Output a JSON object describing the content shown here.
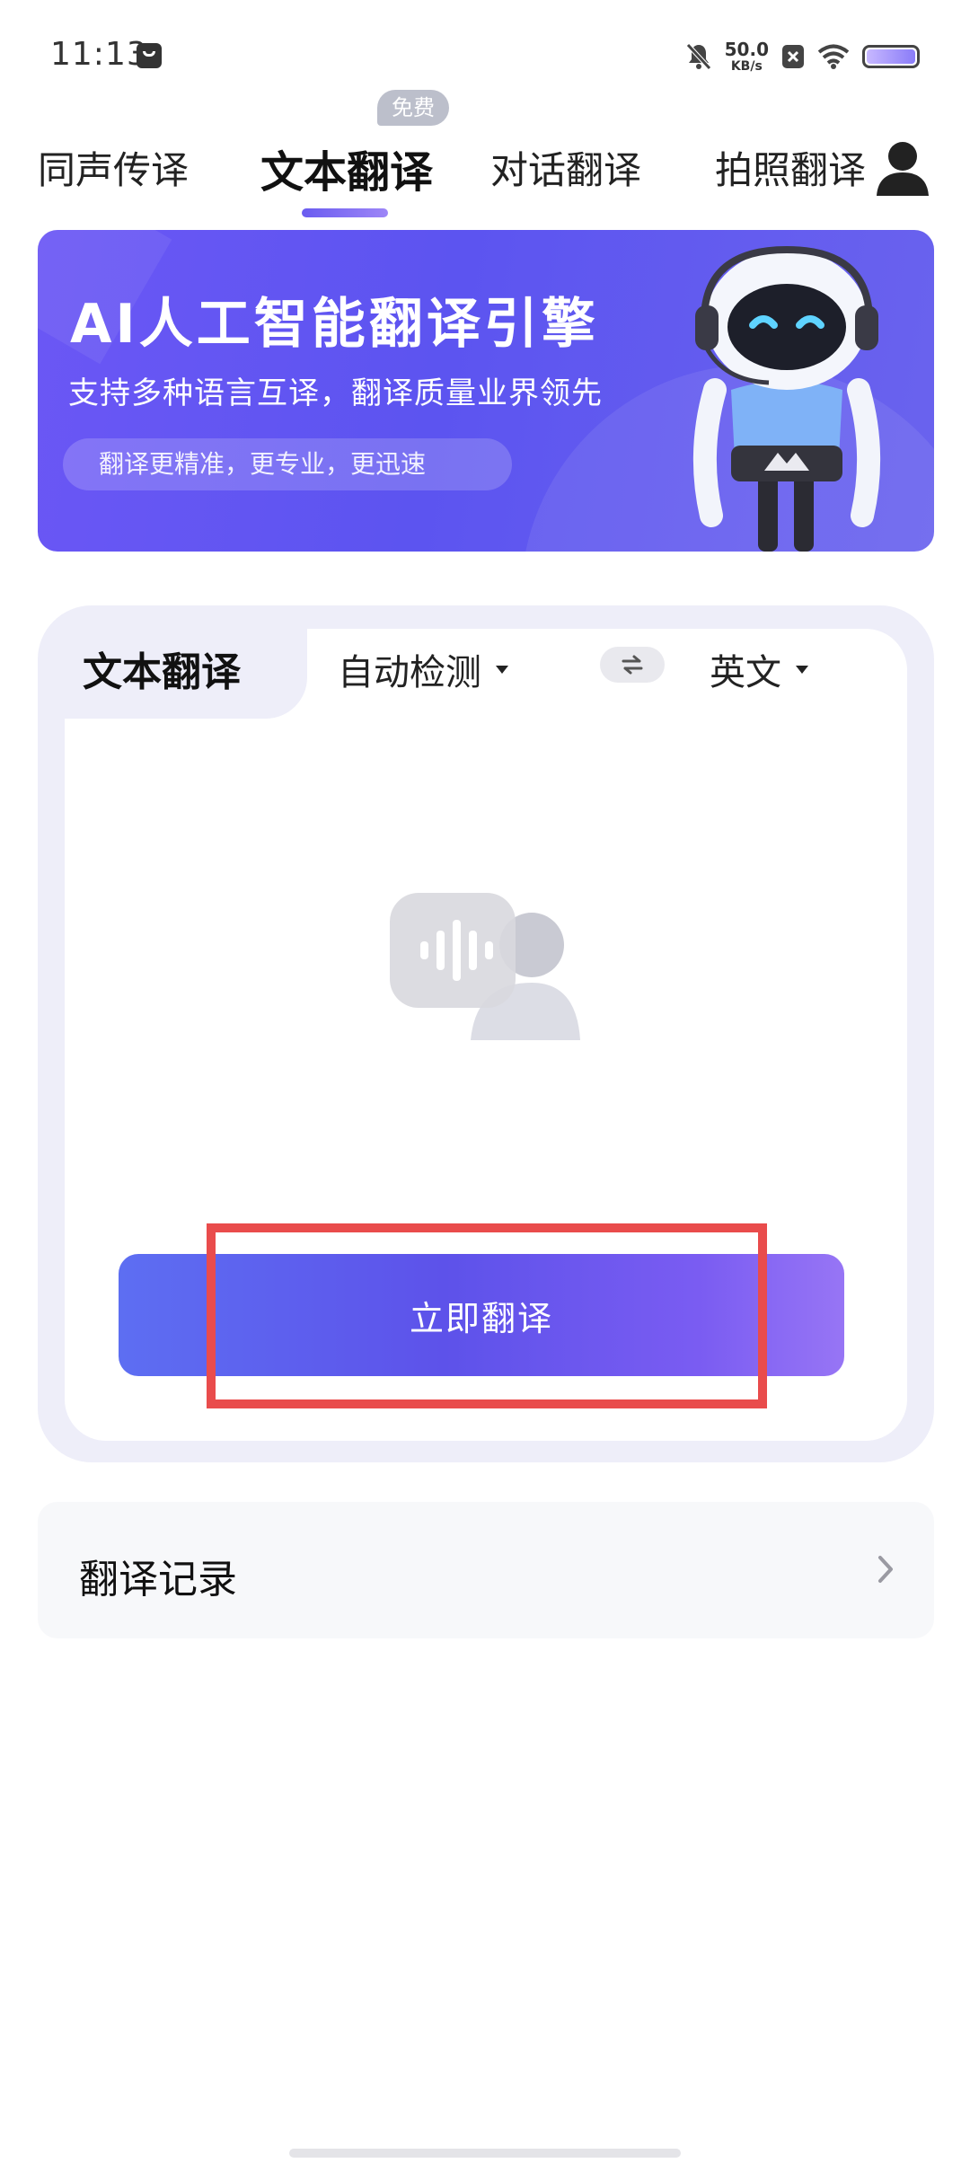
{
  "status_bar": {
    "time": "11:13",
    "network_speed_value": "50.0",
    "network_speed_unit": "KB/s",
    "icons": [
      "message-icon",
      "bell-off-icon",
      "close-box-icon",
      "wifi-icon",
      "battery-icon"
    ]
  },
  "tabs": {
    "items": [
      {
        "label": "同声传译",
        "active": false
      },
      {
        "label": "文本翻译",
        "active": true
      },
      {
        "label": "对话翻译",
        "active": false
      },
      {
        "label": "拍照翻译",
        "active": false
      }
    ],
    "badge": "免费"
  },
  "banner": {
    "title": "AI人工智能翻译引擎",
    "subtitle": "支持多种语言互译，翻译质量业界领先",
    "pill": "翻译更精准，更专业，更迅速"
  },
  "translate_card": {
    "tab_label": "文本翻译",
    "source_language": "自动检测",
    "target_language": "英文",
    "action_label": "立即翻译"
  },
  "history": {
    "label": "翻译记录"
  },
  "colors": {
    "accent": "#5d52ea",
    "highlight": "#e94c4c",
    "card_bg": "#eeeef9"
  }
}
